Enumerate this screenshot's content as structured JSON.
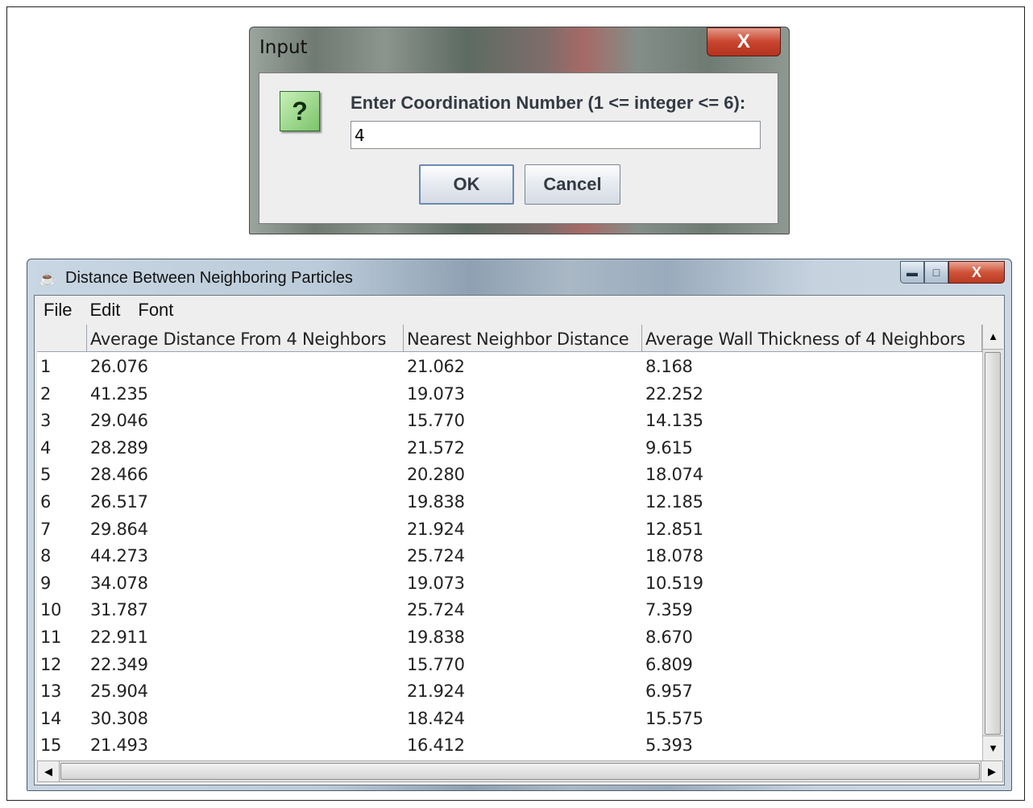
{
  "input_dialog": {
    "title": "Input",
    "close_glyph": "X",
    "icon": "question-icon",
    "icon_glyph": "?",
    "prompt": "Enter Coordination Number (1 <= integer <= 6):",
    "input_value": "4",
    "ok_label": "OK",
    "cancel_label": "Cancel"
  },
  "table_window": {
    "title": "Distance Between Neighboring Particles",
    "app_icon": "java-cup-icon",
    "controls": {
      "minimize": "minimize-icon",
      "maximize": "maximize-icon",
      "close_glyph": "X"
    },
    "menu": [
      "File",
      "Edit",
      "Font"
    ],
    "columns": [
      "",
      "Average Distance From 4 Neighbors",
      "Nearest Neighbor Distance",
      "Average Wall Thickness of 4 Neighbors"
    ],
    "rows": [
      [
        "1",
        "26.076",
        "21.062",
        "8.168"
      ],
      [
        "2",
        "41.235",
        "19.073",
        "22.252"
      ],
      [
        "3",
        "29.046",
        "15.770",
        "14.135"
      ],
      [
        "4",
        "28.289",
        "21.572",
        "9.615"
      ],
      [
        "5",
        "28.466",
        "20.280",
        "18.074"
      ],
      [
        "6",
        "26.517",
        "19.838",
        "12.185"
      ],
      [
        "7",
        "29.864",
        "21.924",
        "12.851"
      ],
      [
        "8",
        "44.273",
        "25.724",
        "18.078"
      ],
      [
        "9",
        "34.078",
        "19.073",
        "10.519"
      ],
      [
        "10",
        "31.787",
        "25.724",
        "7.359"
      ],
      [
        "11",
        "22.911",
        "19.838",
        "8.670"
      ],
      [
        "12",
        "22.349",
        "15.770",
        "6.809"
      ],
      [
        "13",
        "25.904",
        "21.924",
        "6.957"
      ],
      [
        "14",
        "30.308",
        "18.424",
        "15.575"
      ],
      [
        "15",
        "21.493",
        "16.412",
        "5.393"
      ]
    ]
  }
}
